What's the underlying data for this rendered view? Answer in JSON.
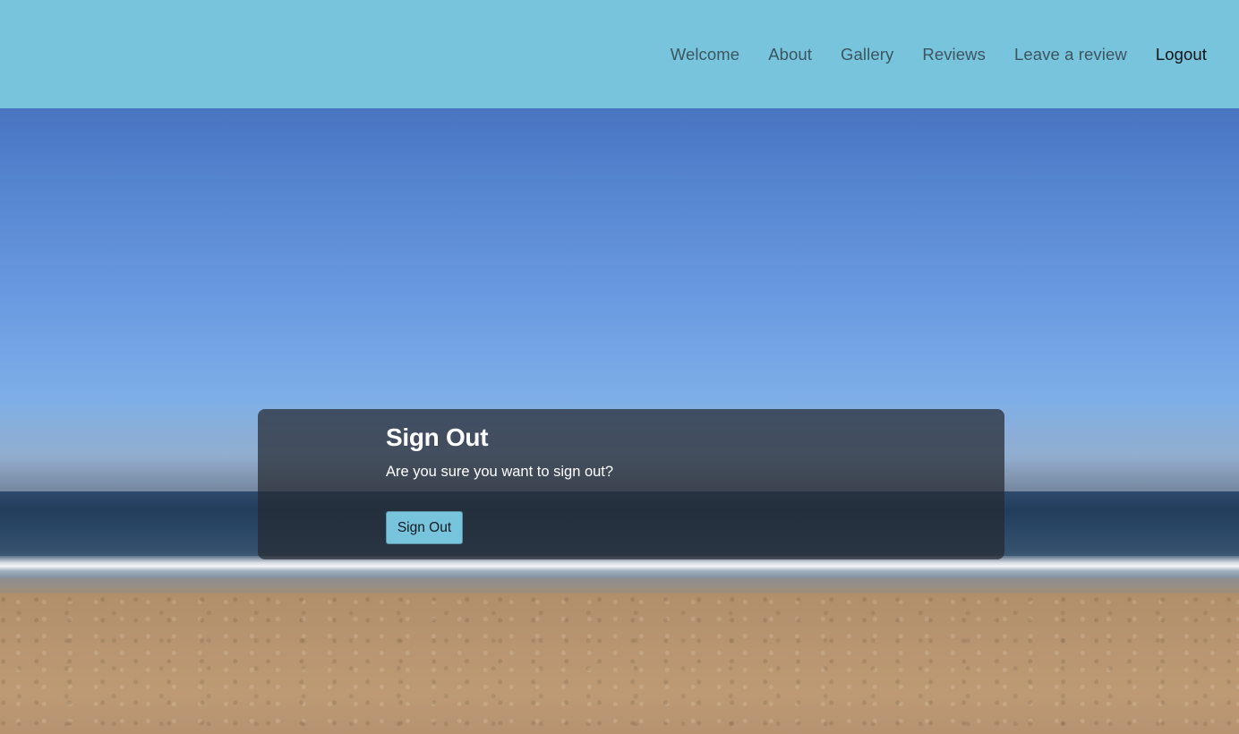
{
  "nav": {
    "items": [
      {
        "label": "Welcome",
        "active": false
      },
      {
        "label": "About",
        "active": false
      },
      {
        "label": "Gallery",
        "active": false
      },
      {
        "label": "Reviews",
        "active": false
      },
      {
        "label": "Leave a review",
        "active": false
      },
      {
        "label": "Logout",
        "active": true
      }
    ]
  },
  "signout": {
    "title": "Sign Out",
    "message": "Are you sure you want to sign out?",
    "button_label": "Sign Out"
  },
  "colors": {
    "navbar": "#79c4dd",
    "button": "#79c4dd",
    "panel": "rgba(38, 42, 50, 0.72)"
  },
  "background": {
    "scene": "beach"
  }
}
